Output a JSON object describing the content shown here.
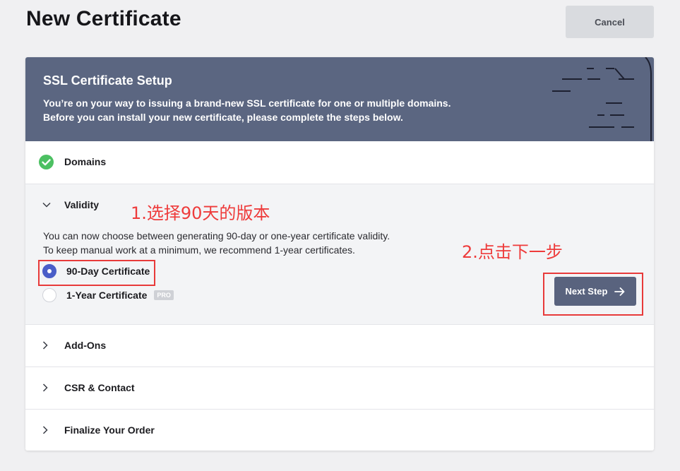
{
  "page": {
    "title": "New Certificate",
    "cancel_label": "Cancel"
  },
  "header": {
    "title": "SSL Certificate Setup",
    "desc_line1": "You’re on your way to issuing a brand-new SSL certificate for one or multiple domains.",
    "desc_line2": "Before you can install your new certificate, please complete the steps below."
  },
  "steps": {
    "domains": "Domains",
    "validity": "Validity",
    "addons": "Add-Ons",
    "csr": "CSR & Contact",
    "finalize": "Finalize Your Order"
  },
  "validity": {
    "info_line1": "You can now choose between generating 90-day or one-year certificate validity.",
    "info_line2": "To keep manual work at a minimum, we recommend 1-year certificates.",
    "options": [
      {
        "label": "90-Day Certificate",
        "selected": true
      },
      {
        "label": "1-Year Certificate",
        "selected": false,
        "badge": "PRO"
      }
    ],
    "next_label": "Next Step"
  },
  "annotations": {
    "note1": "1.选择90天的版本",
    "note2": "2.点击下一步"
  },
  "colors": {
    "header_bg": "#5b6681",
    "primary_button": "#59637e",
    "radio_selected": "#4a5ec8",
    "check_green": "#4cc062",
    "annotation_red": "#e83a3a"
  },
  "icons": [
    "check-circle-icon",
    "chevron-down-icon",
    "chevron-right-icon",
    "arrow-right-icon"
  ]
}
